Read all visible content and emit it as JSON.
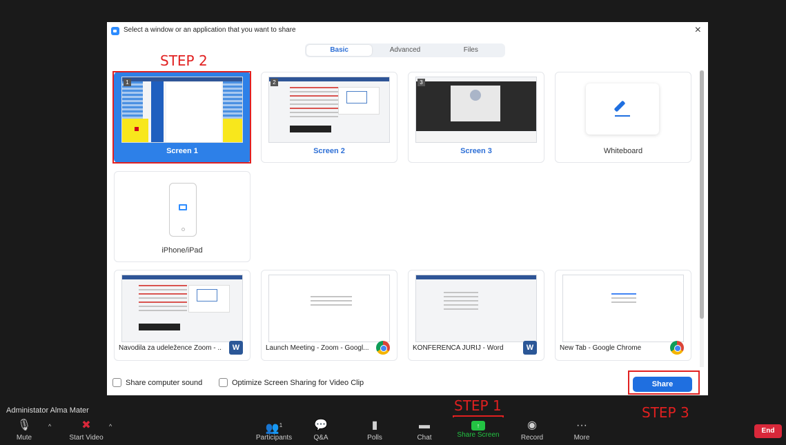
{
  "dialog": {
    "title": "Select a window or an application that you want to share",
    "close_icon": "×",
    "tabs": [
      {
        "label": "Basic",
        "active": true
      },
      {
        "label": "Advanced",
        "active": false
      },
      {
        "label": "Files",
        "active": false
      }
    ],
    "screens": [
      {
        "index": "1",
        "label": "Screen 1",
        "selected": true
      },
      {
        "index": "2",
        "label": "Screen 2",
        "selected": false
      },
      {
        "index": "3",
        "label": "Screen 3",
        "selected": false
      }
    ],
    "whiteboard_label": "Whiteboard",
    "iphone_label": "iPhone/iPad",
    "apps": [
      {
        "label": "Navodila za udeležence Zoom - ...",
        "badge": "word-icon",
        "badge_text": "W"
      },
      {
        "label": "Launch Meeting - Zoom - Googl...",
        "badge": "chrome-icon"
      },
      {
        "label": "KONFERENCA JURIJ - Word",
        "badge": "word-icon",
        "badge_text": "W"
      },
      {
        "label": "New Tab - Google Chrome",
        "badge": "chrome-icon"
      }
    ],
    "share_computer_sound": "Share computer sound",
    "optimize_video": "Optimize Screen Sharing for Video Clip",
    "share_button": "Share"
  },
  "steps": {
    "step1": "STEP 1",
    "step2": "STEP 2",
    "step3": "STEP 3"
  },
  "participant_name": "Administator Alma Mater",
  "toolbar": {
    "mute": "Mute",
    "start_video": "Start Video",
    "participants": "Participants",
    "participants_count": "1",
    "qa": "Q&A",
    "polls": "Polls",
    "chat": "Chat",
    "share_screen": "Share Screen",
    "record": "Record",
    "more": "More",
    "end": "End"
  },
  "colors": {
    "accent": "#2d80e8",
    "annotation_red": "#e12020",
    "share_green": "#23c343",
    "end_red": "#d9283a"
  }
}
